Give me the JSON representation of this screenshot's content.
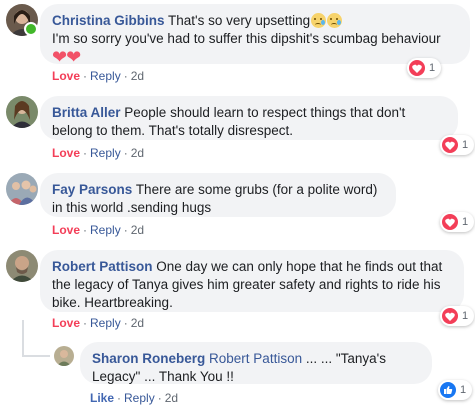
{
  "comments": [
    {
      "author": "Christina Gibbins",
      "text_line1": "That's so very upsetting",
      "text_line2": "I'm so sorry you've had to suffer this dipshit's scumbag behaviour",
      "emojis": [
        "crying-face",
        "crying-face"
      ],
      "extra_emojis": [
        "red-heart",
        "red-heart"
      ],
      "reaction_action": "Love",
      "reply_label": "Reply",
      "time": "2d",
      "reaction_icon": "heart",
      "reaction_count": "1"
    },
    {
      "author": "Britta Aller",
      "text": "People should learn to respect things that don't belong to them. That's totally disrespect.",
      "reaction_action": "Love",
      "reply_label": "Reply",
      "time": "2d",
      "reaction_icon": "heart",
      "reaction_count": "1"
    },
    {
      "author": "Fay Parsons",
      "text": "There are some grubs (for a polite word) in this world .sending hugs",
      "reaction_action": "Love",
      "reply_label": "Reply",
      "time": "2d",
      "reaction_icon": "heart",
      "reaction_count": "1"
    },
    {
      "author": "Robert Pattison",
      "text": "One day we can only hope that he finds out that the legacy of Tanya gives him greater safety and rights to ride his bike. Heartbreaking.",
      "reaction_action": "Love",
      "reply_label": "Reply",
      "time": "2d",
      "reaction_icon": "heart",
      "reaction_count": "1"
    }
  ],
  "reply": {
    "author": "Sharon Roneberg",
    "mention": "Robert Pattison",
    "text": " ... ... \"Tanya's Legacy\" ... Thank You !!",
    "reaction_action": "Like",
    "reply_label": "Reply",
    "time": "2d",
    "reaction_icon": "like",
    "reaction_count": "1"
  },
  "colors": {
    "link": "#385898",
    "love": "#f33e58",
    "like": "#4267b2",
    "bubble": "#f2f3f5",
    "online": "#42b72a"
  }
}
